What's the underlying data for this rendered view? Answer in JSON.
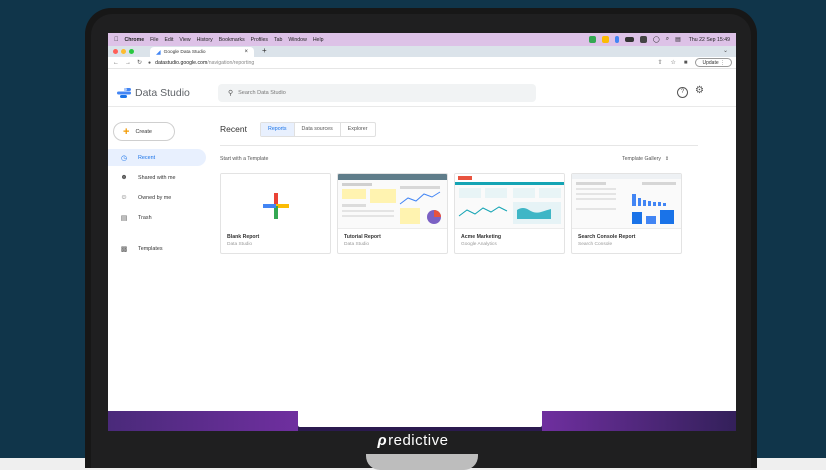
{
  "mac_menubar": {
    "app": "Chrome",
    "items": [
      "File",
      "Edit",
      "View",
      "History",
      "Bookmarks",
      "Profiles",
      "Tab",
      "Window",
      "Help"
    ],
    "datetime": "Thu 22 Sep 15:49",
    "status_colors": [
      "#34a853",
      "#fbbc04",
      "#4285f4",
      "#333333",
      "#444444"
    ]
  },
  "browser": {
    "tab_title": "Google Data Studio",
    "tab_close": "×",
    "new_tab": "+",
    "url_domain": "datastudio.google.com",
    "url_path": "/navigation/reporting",
    "update_label": "Update"
  },
  "app": {
    "title": "Data Studio",
    "search_placeholder": "Search Data Studio"
  },
  "sidebar": {
    "create_label": "Create",
    "items": [
      {
        "label": "Recent",
        "icon": "clock-icon"
      },
      {
        "label": "Shared with me",
        "icon": "people-icon"
      },
      {
        "label": "Owned by me",
        "icon": "person-icon"
      },
      {
        "label": "Trash",
        "icon": "trash-icon"
      },
      {
        "label": "Templates",
        "icon": "templates-icon"
      }
    ]
  },
  "main": {
    "title": "Recent",
    "tabs": [
      "Reports",
      "Data sources",
      "Explorer"
    ],
    "selected_tab": "Reports",
    "start_label": "Start with a Template",
    "gallery_label": "Template Gallery",
    "cards": [
      {
        "title": "Blank Report",
        "subtitle": "Data Studio"
      },
      {
        "title": "Tutorial Report",
        "subtitle": "Data Studio"
      },
      {
        "title": "Acme Marketing",
        "subtitle": "Google Analytics"
      },
      {
        "title": "Search Console Report",
        "subtitle": "Search Console"
      }
    ]
  },
  "brand": {
    "text": "redictive"
  },
  "colors": {
    "accent": "#1a73e8",
    "background": "#10354a",
    "menubar": "#ddc2e7"
  }
}
